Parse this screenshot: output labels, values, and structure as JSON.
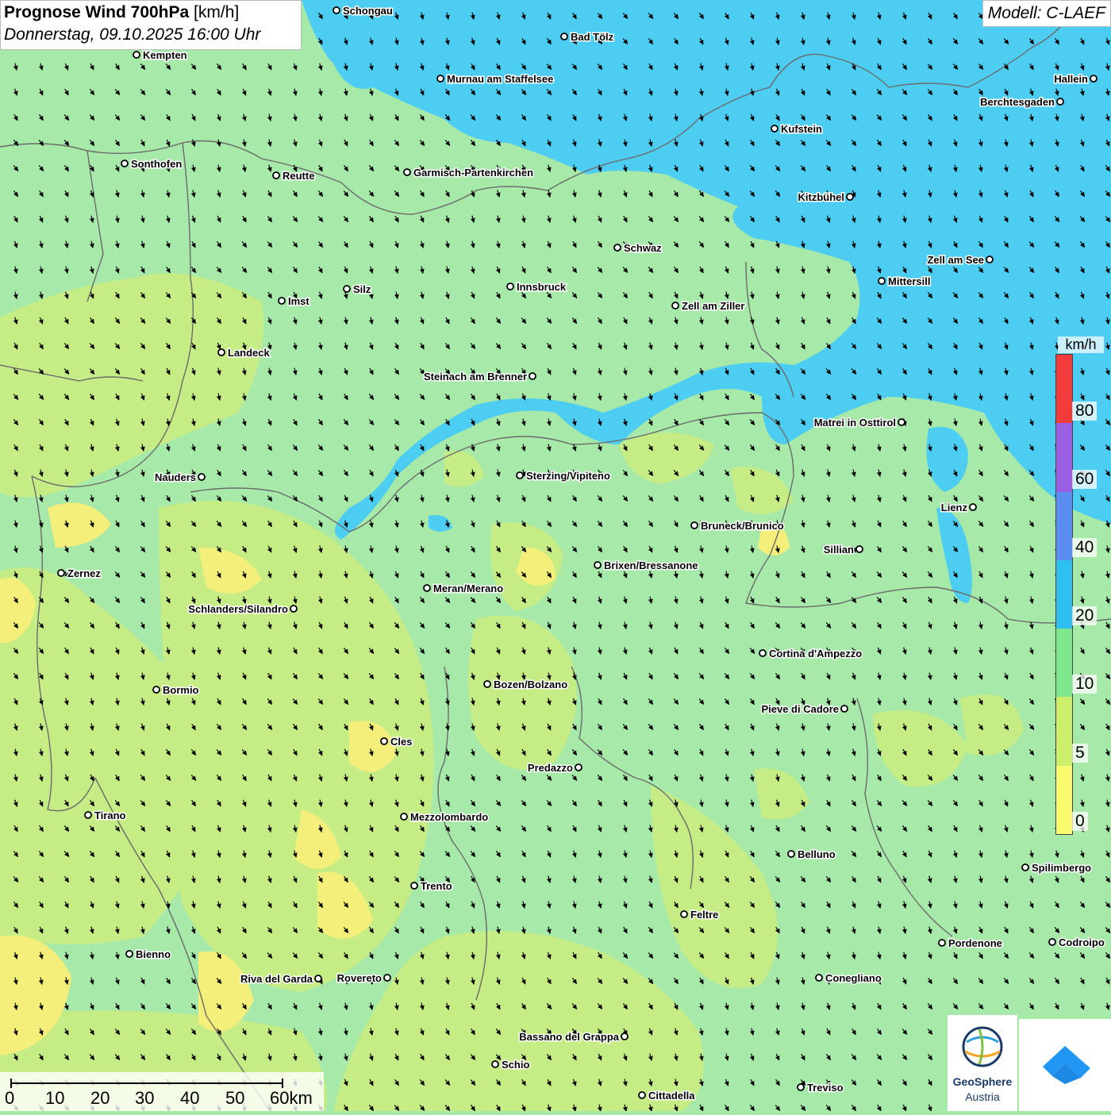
{
  "title": {
    "main": "Prognose Wind 700hPa",
    "unit": "[km/h]",
    "datetime": "Donnerstag, 09.10.2025 16:00 Uhr"
  },
  "model": "Modell: C-LAEF",
  "legend": {
    "unit": "km/h",
    "labels": [
      "80",
      "60",
      "40",
      "20",
      "10",
      "5",
      "0"
    ],
    "colors": [
      "#f23c3c",
      "#9a5fe3",
      "#5a8ef0",
      "#2ec0f0",
      "#7ee88e",
      "#cdf06a",
      "#fafa6e"
    ]
  },
  "colors": {
    "zone_calm": "#f3ef7a",
    "zone_light": "#c6ec85",
    "zone_moderate": "#a6e9a9",
    "zone_fresh": "#4ecdf2"
  },
  "scalebar": {
    "labels": [
      "0",
      "10",
      "20",
      "30",
      "40",
      "50",
      "60km"
    ]
  },
  "logos": {
    "geosphere_line1": "GeoSphere",
    "geosphere_line2": "Austria"
  },
  "cities": [
    {
      "name": "Schongau"
    },
    {
      "name": "Bad Tölz"
    },
    {
      "name": "Kempten"
    },
    {
      "name": "Murnau am Staffelsee"
    },
    {
      "name": "Hallein"
    },
    {
      "name": "Berchtesgaden"
    },
    {
      "name": "Kufstein"
    },
    {
      "name": "Sonthofen"
    },
    {
      "name": "Reutte"
    },
    {
      "name": "Garmisch-Partenkirchen"
    },
    {
      "name": "Kitzbühel"
    },
    {
      "name": "Schwaz"
    },
    {
      "name": "Zell am See"
    },
    {
      "name": "Mittersill"
    },
    {
      "name": "Innsbruck"
    },
    {
      "name": "Silz"
    },
    {
      "name": "Imst"
    },
    {
      "name": "Zell am Ziller"
    },
    {
      "name": "Landeck"
    },
    {
      "name": "Steinach am Brenner"
    },
    {
      "name": "Matrei in Osttirol"
    },
    {
      "name": "Nauders"
    },
    {
      "name": "Sterzing/Vipiteno"
    },
    {
      "name": "Lienz"
    },
    {
      "name": "Bruneck/Brunico"
    },
    {
      "name": "Sillian"
    },
    {
      "name": "Brixen/Bressanone"
    },
    {
      "name": "Zernez"
    },
    {
      "name": "Meran/Merano"
    },
    {
      "name": "Schlanders/Silandro"
    },
    {
      "name": "Cortina d'Ampezzo"
    },
    {
      "name": "Bozen/Bolzano"
    },
    {
      "name": "Bormio"
    },
    {
      "name": "Pieve di Cadore"
    },
    {
      "name": "Cles"
    },
    {
      "name": "Predazzo"
    },
    {
      "name": "Tirano"
    },
    {
      "name": "Mezzolombardo"
    },
    {
      "name": "Belluno"
    },
    {
      "name": "Spilimbergo"
    },
    {
      "name": "Trento"
    },
    {
      "name": "Feltre"
    },
    {
      "name": "Pordenone"
    },
    {
      "name": "Codroipo"
    },
    {
      "name": "Bienno"
    },
    {
      "name": "Riva del Garda"
    },
    {
      "name": "Rovereto"
    },
    {
      "name": "Conegliano"
    },
    {
      "name": "Bassano del Grappa"
    },
    {
      "name": "Schio"
    },
    {
      "name": "Treviso"
    },
    {
      "name": "Cittadella"
    }
  ]
}
